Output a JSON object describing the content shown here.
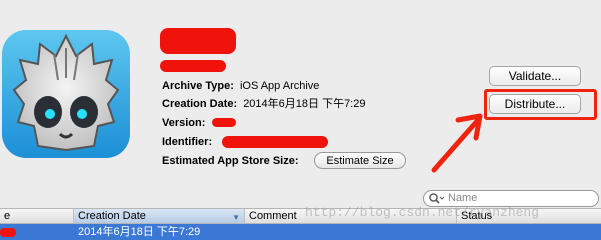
{
  "archive": {
    "type_label": "Archive Type:",
    "type_value": "iOS App Archive",
    "date_label": "Creation Date:",
    "date_value": "2014年6月18日 下午7:29",
    "version_label": "Version:",
    "identifier_label": "Identifier:",
    "est_size_label": "Estimated App Store Size:",
    "estimate_button": "Estimate Size"
  },
  "actions": {
    "validate": "Validate...",
    "distribute": "Distribute..."
  },
  "search": {
    "placeholder": "Name"
  },
  "table": {
    "columns": [
      "e",
      "Creation Date",
      "Comment",
      "Status"
    ],
    "rows": [
      {
        "creation_date": "2014年6月18日 下午7:29",
        "comment": "",
        "status": ""
      }
    ]
  },
  "watermark": "http://blog.csdn.net/ryanzheng",
  "colors": {
    "accent_red": "#f0130b",
    "selection_blue": "#3b78d6"
  }
}
